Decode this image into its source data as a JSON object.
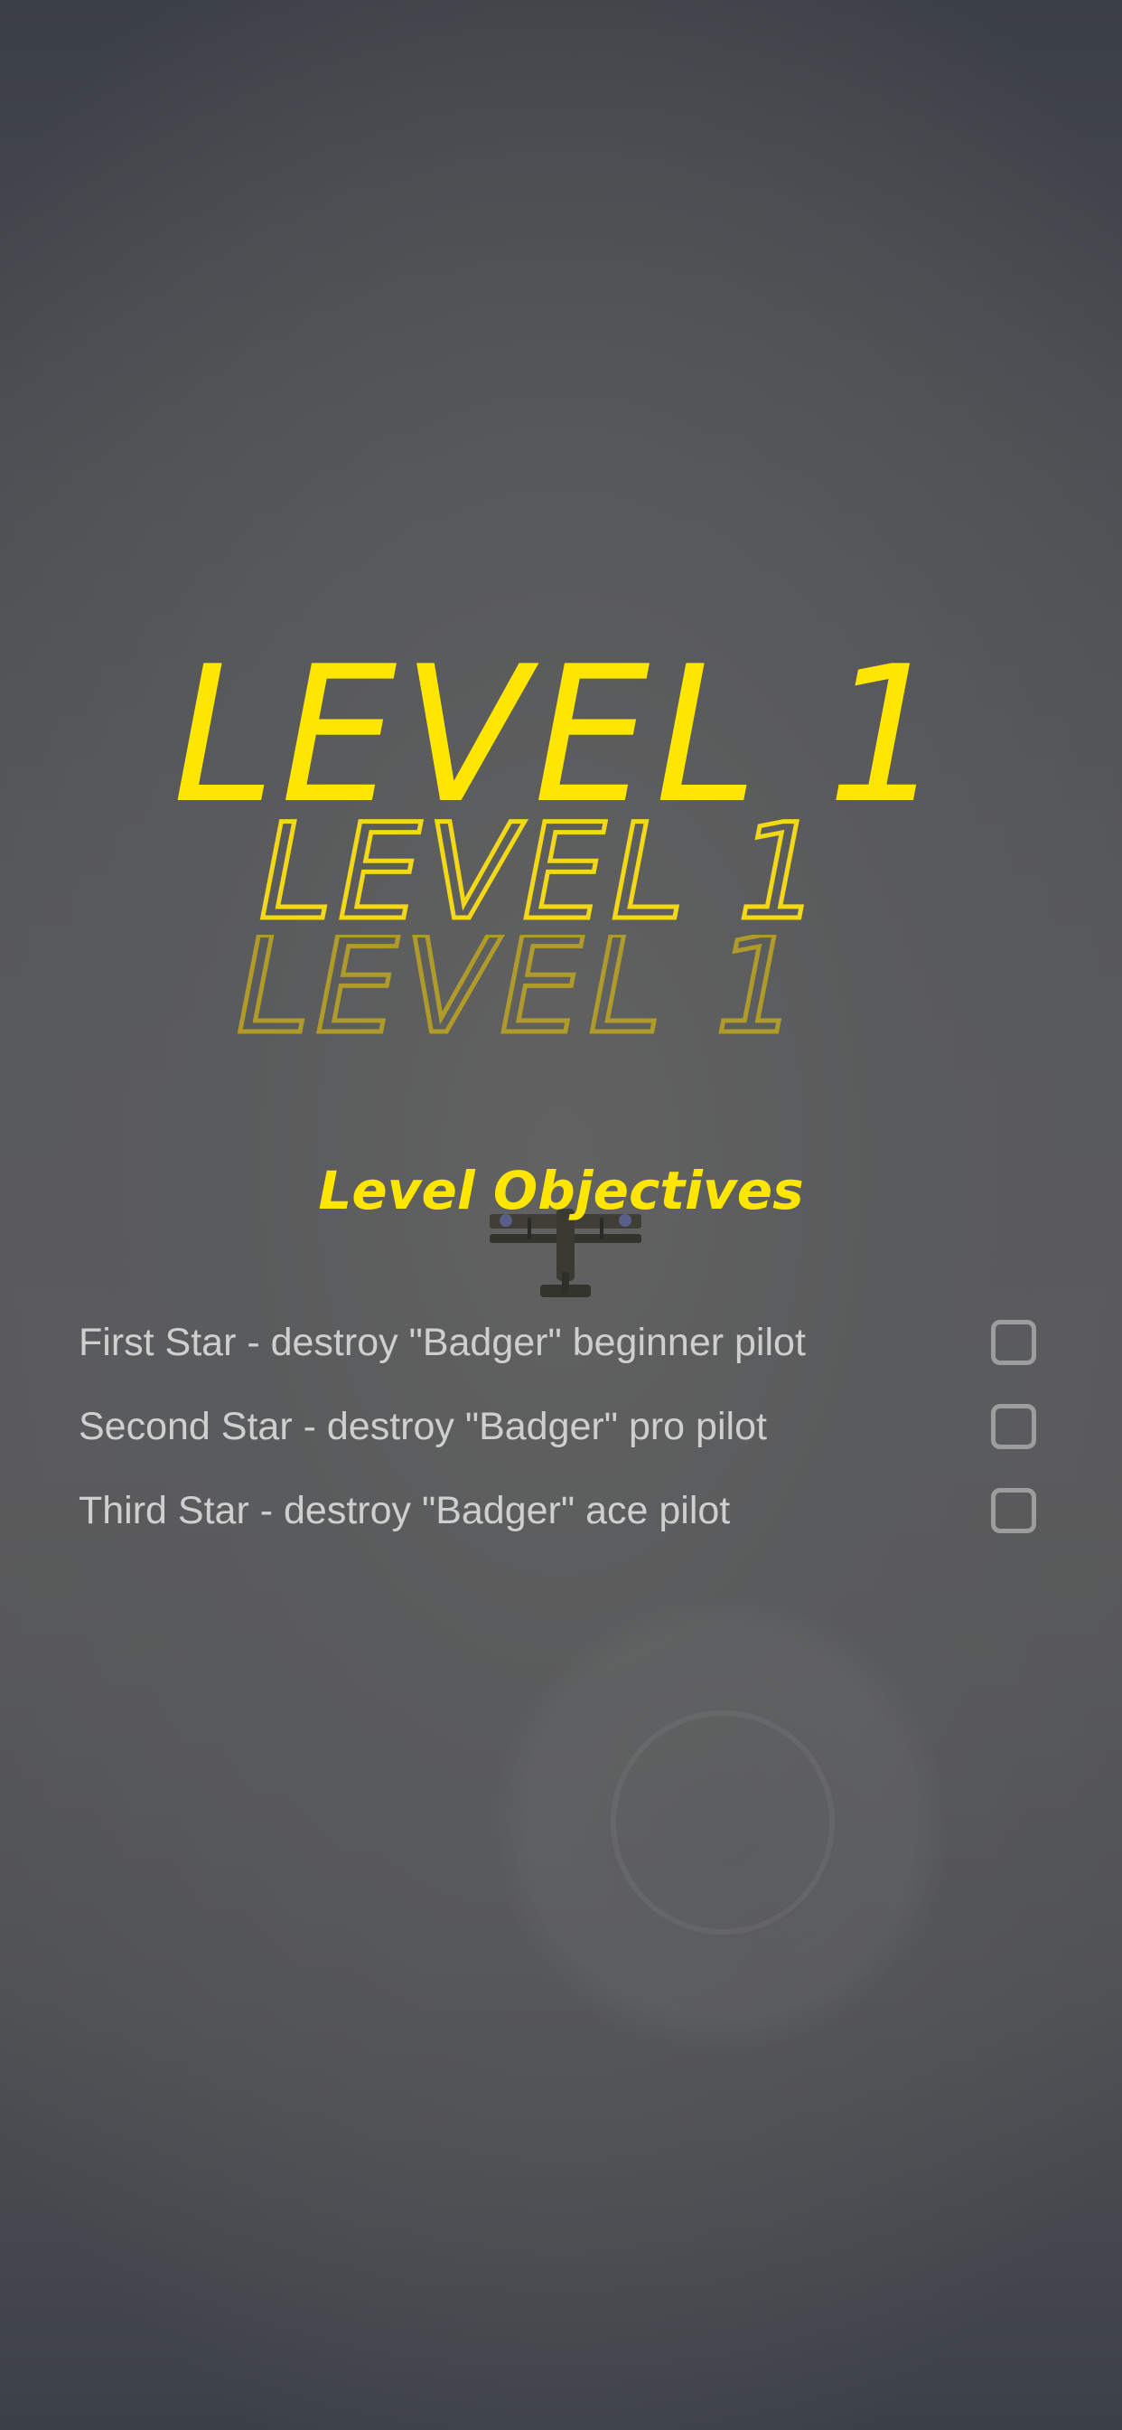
{
  "level": {
    "title": "LEVEL 1"
  },
  "objectives": {
    "heading": "Level Objectives",
    "items": [
      {
        "label": "First Star - destroy \"Badger\" beginner pilot",
        "checked": false
      },
      {
        "label": "Second Star - destroy \"Badger\" pro pilot",
        "checked": false
      },
      {
        "label": "Third Star - destroy \"Badger\" ace pilot",
        "checked": false
      }
    ]
  },
  "colors": {
    "accent": "#ffe600",
    "text": "#cfcfcf",
    "checkbox_border": "#9d9d9d"
  },
  "icons": {
    "plane": "biplane-icon",
    "joystick": "joystick-icon"
  }
}
